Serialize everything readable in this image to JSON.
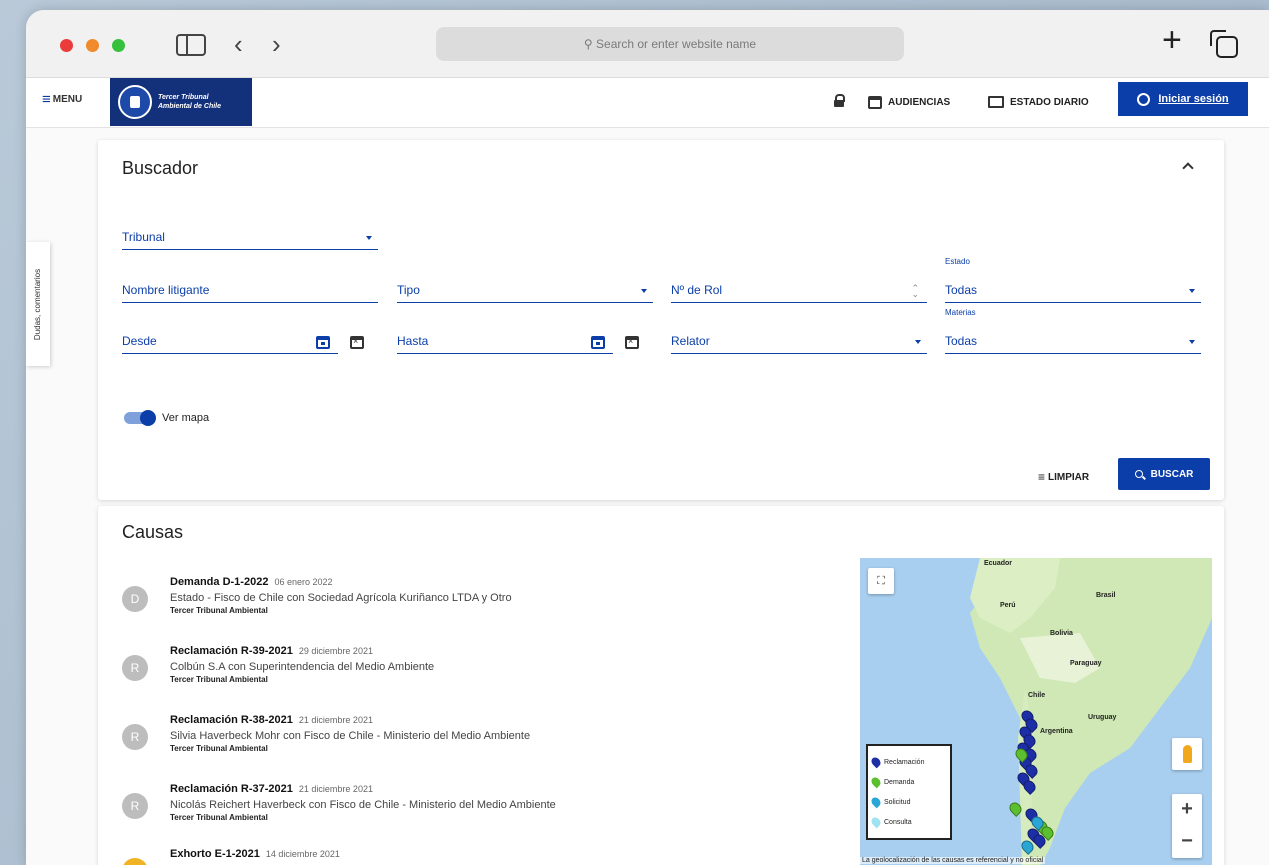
{
  "browser": {
    "url_placeholder": "Search or enter website name"
  },
  "header": {
    "menu_label": "MENU",
    "logo_line1": "Tercer Tribunal",
    "logo_line2": "Ambiental de Chile",
    "audiencias": "AUDIENCIAS",
    "estado_diario": "ESTADO DIARIO",
    "login": "Iniciar sesión"
  },
  "feedback_tab": "Dudas, comentarios",
  "buscador": {
    "title": "Buscador",
    "fields": {
      "tribunal": "Tribunal",
      "nombre_litigante": "Nombre litigante",
      "tipo": "Tipo",
      "rol": "Nº de Rol",
      "estado_label": "Estado",
      "estado_value": "Todas",
      "desde": "Desde",
      "hasta": "Hasta",
      "relator": "Relator",
      "materias_label": "Materias",
      "materias_value": "Todas"
    },
    "ver_mapa": "Ver mapa",
    "limpiar": "LIMPIAR",
    "buscar": "BUSCAR"
  },
  "causas": {
    "title": "Causas",
    "items": [
      {
        "avatar": "D",
        "title": "Demanda D-1-2022",
        "date": "06 enero 2022",
        "desc": "Estado - Fisco de Chile con Sociedad Agrícola Kuriñanco LTDA y Otro",
        "court": "Tercer Tribunal Ambiental"
      },
      {
        "avatar": "R",
        "title": "Reclamación R-39-2021",
        "date": "29 diciembre 2021",
        "desc": "Colbún S.A con Superintendencia del Medio Ambiente",
        "court": "Tercer Tribunal Ambiental"
      },
      {
        "avatar": "R",
        "title": "Reclamación R-38-2021",
        "date": "21 diciembre 2021",
        "desc": "Silvia Haverbeck Mohr con Fisco de Chile - Ministerio del Medio Ambiente",
        "court": "Tercer Tribunal Ambiental"
      },
      {
        "avatar": "R",
        "title": "Reclamación R-37-2021",
        "date": "21 diciembre 2021",
        "desc": "Nicolás Reichert Haverbeck con Fisco de Chile - Ministerio del Medio Ambiente",
        "court": "Tercer Tribunal Ambiental"
      },
      {
        "avatar": "E",
        "title": "Exhorto E-1-2021",
        "date": "14 diciembre 2021",
        "desc": "",
        "court": ""
      }
    ]
  },
  "map": {
    "countries": [
      "Ecuador",
      "Brasil",
      "Perú",
      "Bolivia",
      "Paraguay",
      "Chile",
      "Argentina",
      "Uruguay"
    ],
    "legend": [
      {
        "label": "Reclamación",
        "color": "#1d2fa6"
      },
      {
        "label": "Demanda",
        "color": "#5bbf2e"
      },
      {
        "label": "Solicitud",
        "color": "#2aa6d6"
      },
      {
        "label": "Consulta",
        "color": "#9fe3f0"
      }
    ],
    "note": "La geolocalización de las causas es referencial y no oficial"
  },
  "colors": {
    "primary": "#0b3ea8",
    "logo_bg": "#13317b"
  }
}
